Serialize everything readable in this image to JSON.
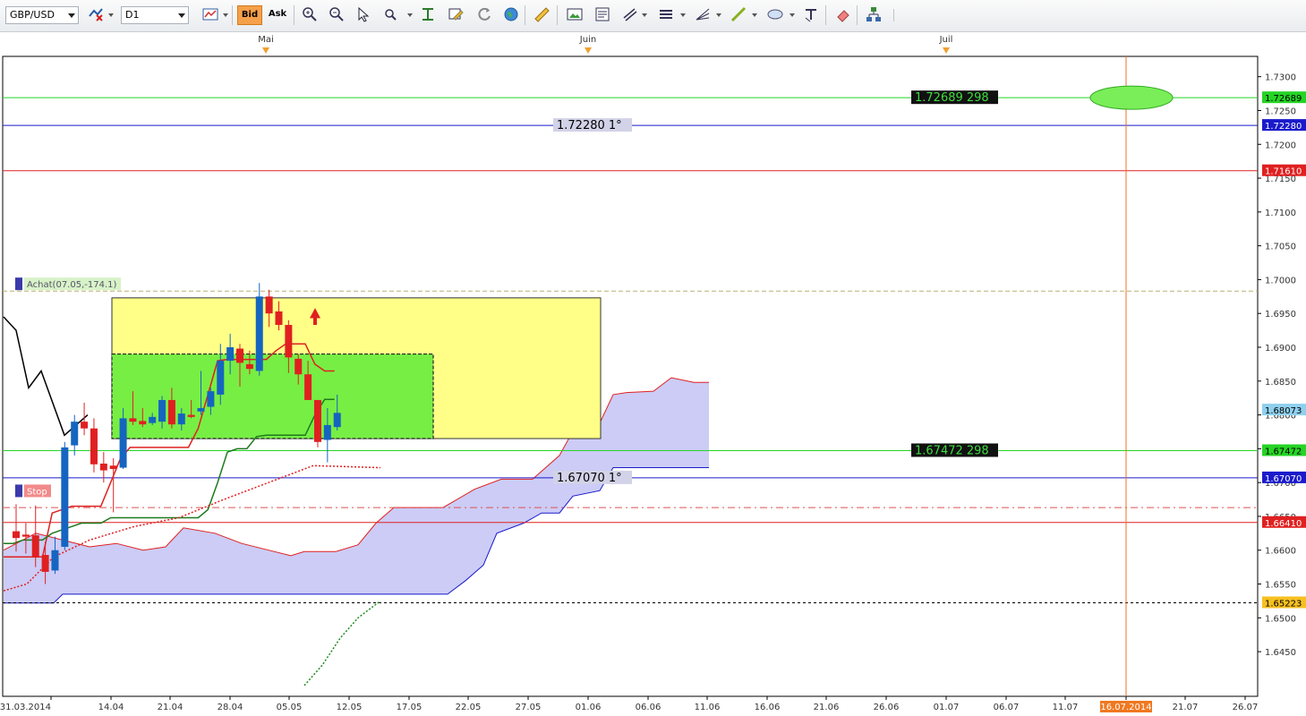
{
  "toolbar": {
    "symbol": "GBP/USD",
    "timeframe": "D1",
    "bid_label": "Bid",
    "ask_label": "Ask"
  },
  "chart_data": {
    "type": "candlestick",
    "symbol": "GBP/USD",
    "timeframe": "D1",
    "ylim": [
      1.642,
      1.732
    ],
    "y_ticks": [
      "1.7300",
      "1.7250",
      "1.7200",
      "1.7150",
      "1.7100",
      "1.7050",
      "1.7000",
      "1.6950",
      "1.6900",
      "1.6850",
      "1.6800",
      "1.6750",
      "1.6700",
      "1.6650",
      "1.6600",
      "1.6550",
      "1.6500",
      "1.6450"
    ],
    "x_ticks": [
      "31.03.2014",
      "14.04",
      "21.04",
      "28.04",
      "05.05",
      "12.05",
      "17.05",
      "22.05",
      "27.05",
      "01.06",
      "06.06",
      "11.06",
      "16.06",
      "21.06",
      "26.06",
      "01.07",
      "06.07",
      "11.07",
      "16.07.2014",
      "21.07",
      "26.07"
    ],
    "month_labels": [
      "Mai",
      "Juin",
      "Juil"
    ],
    "candles": [
      {
        "o": 1.6628,
        "h": 1.6668,
        "l": 1.6598,
        "c": 1.6618
      },
      {
        "o": 1.6623,
        "h": 1.664,
        "l": 1.6595,
        "c": 1.662
      },
      {
        "o": 1.6622,
        "h": 1.6666,
        "l": 1.6575,
        "c": 1.659
      },
      {
        "o": 1.6593,
        "h": 1.6612,
        "l": 1.655,
        "c": 1.6568
      },
      {
        "o": 1.657,
        "h": 1.662,
        "l": 1.6565,
        "c": 1.66
      },
      {
        "o": 1.6605,
        "h": 1.676,
        "l": 1.66,
        "c": 1.6752
      },
      {
        "o": 1.6755,
        "h": 1.68,
        "l": 1.674,
        "c": 1.679
      },
      {
        "o": 1.679,
        "h": 1.6818,
        "l": 1.677,
        "c": 1.678
      },
      {
        "o": 1.678,
        "h": 1.6795,
        "l": 1.6715,
        "c": 1.6727
      },
      {
        "o": 1.6728,
        "h": 1.6745,
        "l": 1.67,
        "c": 1.6718
      },
      {
        "o": 1.6725,
        "h": 1.6736,
        "l": 1.6656,
        "c": 1.672
      },
      {
        "o": 1.6722,
        "h": 1.681,
        "l": 1.672,
        "c": 1.6795
      },
      {
        "o": 1.6795,
        "h": 1.6835,
        "l": 1.6785,
        "c": 1.679
      },
      {
        "o": 1.6791,
        "h": 1.681,
        "l": 1.6782,
        "c": 1.6786
      },
      {
        "o": 1.6788,
        "h": 1.6803,
        "l": 1.6785,
        "c": 1.6797
      },
      {
        "o": 1.679,
        "h": 1.6828,
        "l": 1.678,
        "c": 1.6822
      },
      {
        "o": 1.6822,
        "h": 1.684,
        "l": 1.678,
        "c": 1.6786
      },
      {
        "o": 1.6786,
        "h": 1.681,
        "l": 1.6777,
        "c": 1.6802
      },
      {
        "o": 1.68,
        "h": 1.6822,
        "l": 1.6795,
        "c": 1.6797
      },
      {
        "o": 1.6805,
        "h": 1.6865,
        "l": 1.68,
        "c": 1.681
      },
      {
        "o": 1.6812,
        "h": 1.684,
        "l": 1.68,
        "c": 1.6835
      },
      {
        "o": 1.683,
        "h": 1.6905,
        "l": 1.6815,
        "c": 1.688
      },
      {
        "o": 1.688,
        "h": 1.692,
        "l": 1.686,
        "c": 1.69
      },
      {
        "o": 1.6898,
        "h": 1.6905,
        "l": 1.6842,
        "c": 1.6877
      },
      {
        "o": 1.6875,
        "h": 1.6895,
        "l": 1.686,
        "c": 1.6868
      },
      {
        "o": 1.6865,
        "h": 1.6995,
        "l": 1.6858,
        "c": 1.6975
      },
      {
        "o": 1.6975,
        "h": 1.6985,
        "l": 1.693,
        "c": 1.695
      },
      {
        "o": 1.6953,
        "h": 1.6968,
        "l": 1.6925,
        "c": 1.6933
      },
      {
        "o": 1.6933,
        "h": 1.694,
        "l": 1.6862,
        "c": 1.6885
      },
      {
        "o": 1.6883,
        "h": 1.689,
        "l": 1.6845,
        "c": 1.686
      },
      {
        "o": 1.686,
        "h": 1.688,
        "l": 1.683,
        "c": 1.6822
      },
      {
        "o": 1.6822,
        "h": 1.6822,
        "l": 1.6752,
        "c": 1.676
      },
      {
        "o": 1.6763,
        "h": 1.681,
        "l": 1.673,
        "c": 1.6785
      },
      {
        "o": 1.6782,
        "h": 1.683,
        "l": 1.6777,
        "c": 1.6803
      }
    ],
    "ichimoku": {
      "tenkan": [
        1.659,
        1.659,
        1.659,
        1.659,
        1.659,
        1.6655,
        1.666,
        1.6665,
        1.6665,
        1.6665,
        1.6665,
        1.67,
        1.6735,
        1.6752,
        1.6752,
        1.6752,
        1.6752,
        1.6752,
        1.6752,
        1.6752,
        1.678,
        1.683,
        1.688,
        1.6882,
        1.6882,
        1.6882,
        1.6882,
        1.6882,
        1.6895,
        1.6905,
        1.6905,
        1.6905,
        1.6875,
        1.6865,
        1.6865
      ],
      "kijun": [
        1.661,
        1.661,
        1.6615,
        1.6615,
        1.6615,
        1.6625,
        1.663,
        1.6635,
        1.664,
        1.664,
        1.664,
        1.6648,
        1.6648,
        1.6648,
        1.6648,
        1.6648,
        1.6648,
        1.6648,
        1.6648,
        1.6648,
        1.6648,
        1.666,
        1.67,
        1.6745,
        1.675,
        1.675,
        1.6768,
        1.677,
        1.677,
        1.677,
        1.677,
        1.677,
        1.68,
        1.6823,
        1.6823
      ],
      "chikou": [
        1.6945,
        1.6925,
        1.684,
        1.6865,
        1.677,
        1.68
      ]
    },
    "horizontal_lines": [
      {
        "name": "resistance-green-top",
        "price": 1.72689,
        "label": "1.72689",
        "tag": "1.72689 298",
        "color": "#25d425"
      },
      {
        "name": "target-blue-top",
        "price": 1.7228,
        "label": "1.72280",
        "tag": "1.72280 1°",
        "color": "#1a1acc"
      },
      {
        "name": "red-level-top",
        "price": 1.7161,
        "label": "1.71610",
        "color": "#e02020"
      },
      {
        "name": "support-green",
        "price": 1.67472,
        "label": "1.67472",
        "tag": "1.67472 298",
        "color": "#25d425"
      },
      {
        "name": "target-blue-bottom",
        "price": 1.6707,
        "label": "1.67070",
        "tag": "1.67070 1°",
        "color": "#1a1acc"
      },
      {
        "name": "red-level-bottom",
        "price": 1.6641,
        "label": "1.66410",
        "color": "#e02020"
      },
      {
        "name": "stop-dotted",
        "price": 1.65223,
        "label": "1.65223",
        "color": "#000000"
      }
    ],
    "current_price": "1.68073",
    "cursor_date": "16.07.2014",
    "annotations": {
      "buy": "Achat(07.05,-174.1)",
      "stop": "Stop"
    }
  },
  "colors": {
    "toolbar_bg": "#eceef1",
    "bull_candle": "#1565c0",
    "bear_candle": "#e02020",
    "cloud_fill": "#c9c9f5",
    "yellow_box": "#ffff88",
    "green_box": "#77ee44"
  }
}
